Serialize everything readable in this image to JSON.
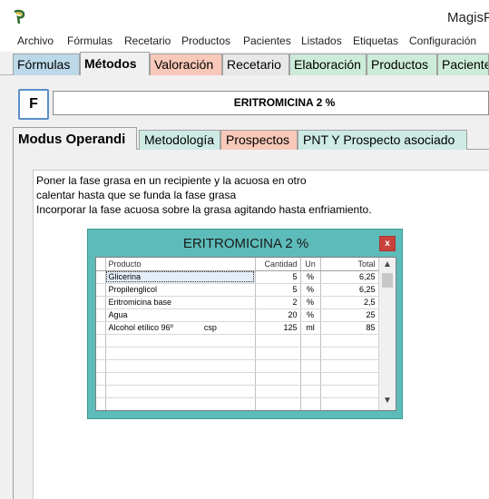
{
  "window": {
    "title": "MagisF"
  },
  "menu": [
    "Archivo",
    "Fórmulas",
    "Recetario",
    "Productos",
    "Pacientes",
    "Listados",
    "Etiquetas",
    "Configuración"
  ],
  "top_tabs": [
    "Fórmulas",
    "Métodos",
    "Valoración",
    "Recetario",
    "Elaboración",
    "Productos",
    "Pacientes"
  ],
  "form": {
    "f_button": "F",
    "title_value": "ERITROMICINA 2 %"
  },
  "sub_tabs": [
    "Modus Operandi",
    "Metodología",
    "Prospectos",
    "PNT Y Prospecto asociado"
  ],
  "modus_text": [
    "Poner la fase grasa en un recipiente y la acuosa en otro",
    "calentar hasta que se funda la fase grasa",
    "Incorporar la fase acuosa sobre la grasa agitando hasta enfriamiento."
  ],
  "dialog": {
    "title": "ERITROMICINA 2 %",
    "close": "x",
    "columns": [
      "Producto",
      "Cantidad",
      "Un",
      "Total"
    ],
    "rows": [
      {
        "producto": "Glicerina",
        "csp": "",
        "cantidad": "5",
        "un": "%",
        "total": "6,25"
      },
      {
        "producto": "Propilenglicol",
        "csp": "",
        "cantidad": "5",
        "un": "%",
        "total": "6,25"
      },
      {
        "producto": "Eritromicina base",
        "csp": "",
        "cantidad": "2",
        "un": "%",
        "total": "2,5"
      },
      {
        "producto": "Agua",
        "csp": "",
        "cantidad": "20",
        "un": "%",
        "total": "25"
      },
      {
        "producto": "Alcohol etílico 96º",
        "csp": "csp",
        "cantidad": "125",
        "un": "ml",
        "total": "85"
      }
    ]
  },
  "colors": {
    "dialog_bg": "#5dbcba",
    "tab_blue": "#bcd9ea",
    "tab_salmon": "#f8c8b8",
    "tab_green": "#cdebd9",
    "close_red": "#c9433c"
  },
  "icons": [
    "app-icon",
    "close-icon",
    "scroll-up-icon",
    "scroll-down-icon"
  ]
}
